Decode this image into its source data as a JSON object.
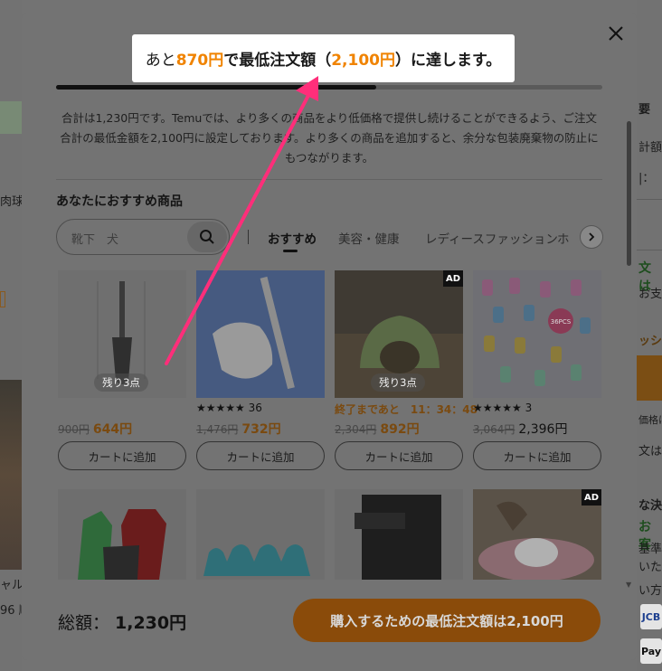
{
  "background": {
    "left_fragments": [
      "肉球",
      "ャルマ",
      "96 順"
    ],
    "right_fragments": [
      "要",
      "計額",
      "|：",
      "文は",
      "お支払",
      "ッシュ",
      "価格は",
      "文は、",
      "な決済",
      "お客",
      "基準に",
      "いたし",
      "い方法",
      "JCB",
      "Pay"
    ]
  },
  "callout": {
    "prefix": "あと",
    "remaining": "870円",
    "middle": "で最低注文額（",
    "minimum": "2,100円",
    "suffix": "）に達します。"
  },
  "progress": {
    "current": 1230,
    "target": 2100
  },
  "notice": "合計は1,230円です。Temuでは、より多くの商品をより低価格で提供し続けることができるよう、ご注文合計の最低金額を2,100円に設定しております。より多くの商品を追加すると、余分な包装廃棄物の防止にもつながります。",
  "section_title": "あなたにおすすめ商品",
  "search": {
    "placeholder": "靴下　犬"
  },
  "tabs": [
    "おすすめ",
    "美容・健康",
    "レディースファッション",
    "ホ"
  ],
  "products": [
    {
      "badge": "残り3点",
      "rating_stars": "",
      "rating_count": "",
      "timer": "",
      "old_price": "900円",
      "price": "644円",
      "cart": "カートに追加",
      "ad": false
    },
    {
      "badge": "",
      "rating_stars": "★★★★★",
      "rating_count": "36",
      "timer": "",
      "old_price": "1,476円",
      "price": "732円",
      "cart": "カートに追加",
      "ad": false
    },
    {
      "badge": "残り3点",
      "rating_stars": "",
      "rating_count": "",
      "timer": "終了まであと　11：34：48",
      "old_price": "2,304円",
      "price": "892円",
      "cart": "カートに追加",
      "ad": true
    },
    {
      "badge": "",
      "rating_stars": "★★★★★",
      "rating_count": "3",
      "timer": "",
      "old_price": "3,064円",
      "price": "2,396円",
      "cart": "カートに追加",
      "ad": false
    }
  ],
  "ad_label": "AD",
  "second_row_ad": "AD",
  "image_text": {
    "socks_pack": "36PCS"
  },
  "footer": {
    "total_label": "総額：",
    "total_value": "1,230円",
    "buy_button": "購入するための最低注文額は2,100円"
  },
  "colors": {
    "accent": "#f08300",
    "arrow": "#ff2e7a",
    "buy_button": "#8a4b0a"
  }
}
